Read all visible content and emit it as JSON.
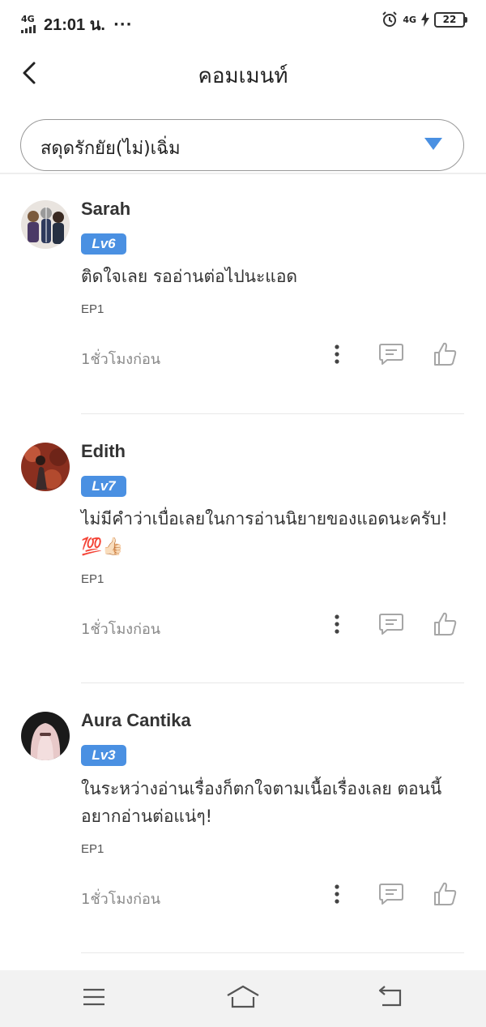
{
  "status_bar": {
    "network": "4G",
    "time": "21:01 น.",
    "dots": "···",
    "network_right": "4G",
    "battery": "22"
  },
  "header": {
    "title": "คอมเมนท์",
    "back_icon": "chevron-left-icon"
  },
  "selector": {
    "value": "สดุดรักยัย(ไม่)เฉิ่ม",
    "arrow_icon": "triangle-down-icon",
    "arrow_color": "#4a90e2"
  },
  "comments": [
    {
      "name": "Sarah",
      "level": "Lv6",
      "text": "ติดใจเลย รออ่านต่อไปนะแอด",
      "episode": "EP1",
      "time": "1ชั่วโมงก่อน"
    },
    {
      "name": "Edith",
      "level": "Lv7",
      "text": "ไม่มีคำว่าเบื่อเลยในการอ่านนิยายของแอดนะครับ! 💯👍🏻",
      "episode": "EP1",
      "time": "1ชั่วโมงก่อน"
    },
    {
      "name": "Aura Cantika",
      "level": "Lv3",
      "text": "ในระหว่างอ่านเรื่องก็ตกใจตามเนื้อเรื่องเลย ตอนนี้อยากอ่านต่อแน่ๆ!",
      "episode": "EP1",
      "time": "1ชั่วโมงก่อน"
    }
  ],
  "colors": {
    "level_badge": "#4a90e2",
    "icon_gray": "#a6a6a6"
  },
  "nav_bar": {
    "menu_icon": "menu-icon",
    "home_icon": "home-icon",
    "back_icon": "back-arrow-icon"
  }
}
